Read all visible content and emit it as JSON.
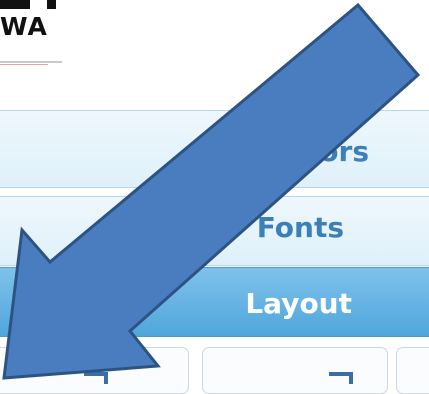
{
  "logo": {
    "text": "WA"
  },
  "tabs": [
    {
      "label": "Colors",
      "state": "default"
    },
    {
      "label": "Fonts",
      "state": "default"
    },
    {
      "label": "Layout",
      "state": "selected"
    }
  ],
  "thumbnails": [
    {
      "label": ""
    },
    {
      "label": ""
    },
    {
      "label": ""
    }
  ],
  "colors": {
    "tab_text": "#3c7fb9",
    "tab_selected_bg": "#5fb0e3",
    "arrow_fill": "#4a7dbf",
    "arrow_stroke": "#2d5383"
  },
  "overlay": {
    "icon": "arrow-down-left-icon"
  }
}
